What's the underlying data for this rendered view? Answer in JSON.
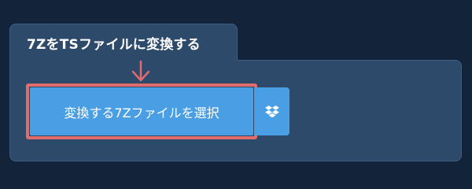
{
  "panel": {
    "title": "7ZをTSファイルに変換する"
  },
  "select_button": {
    "label": "変換する7Zファイルを選択"
  },
  "dropbox_button": {
    "icon": "dropbox-icon"
  },
  "colors": {
    "page_background": "#13233a",
    "panel_background": "#2d4a6a",
    "button_blue": "#4a9fe4",
    "highlight_red": "#e06c6c"
  }
}
